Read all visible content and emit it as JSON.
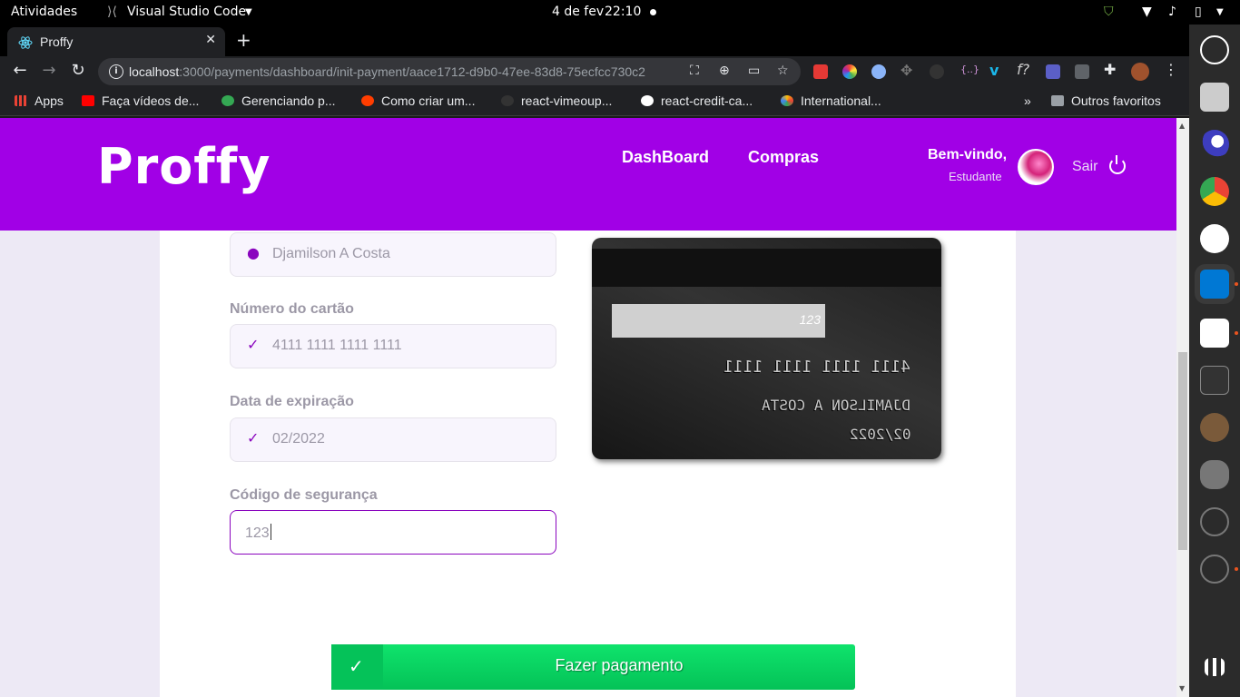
{
  "system_bar": {
    "activities": "Atividades",
    "app_name": "Visual Studio Code",
    "date": "4 de fev",
    "time": "22:10"
  },
  "browser": {
    "tab_title": "Proffy",
    "url_host": "localhost",
    "url_path": ":3000/payments/dashboard/init-payment/aace1712-d9b0-47ee-83d8-75ecfcc730c2",
    "bookmarks": [
      {
        "label": "Apps",
        "color": "#e94235"
      },
      {
        "label": "Faça vídeos de...",
        "color": "#ff0000"
      },
      {
        "label": "Gerenciando p...",
        "color": "#34a853"
      },
      {
        "label": "Como criar um...",
        "color": "#ff3d00"
      },
      {
        "label": "react-vimeoup...",
        "color": "#333333"
      },
      {
        "label": "react-credit-ca...",
        "color": "#ffffff"
      },
      {
        "label": "International...",
        "color": "#ff9800"
      }
    ],
    "overflow": "»",
    "other_bookmarks": "Outros favoritos"
  },
  "header": {
    "logo": "Proffy",
    "nav": [
      "DashBoard",
      "Compras"
    ],
    "welcome": "Bem-vindo,",
    "role": "Estudante",
    "logout": "Sair"
  },
  "form": {
    "name_value": "Djamilson A Costa",
    "card_number_label": "Número do cartão",
    "card_number_value": "4111 1111 1111 1111",
    "expiry_label": "Data de expiração",
    "expiry_value": "02/2022",
    "cvc_label": "Código de segurança",
    "cvc_value": "123"
  },
  "card_preview": {
    "cvc": "123",
    "number": "4111 1111 1111 1111",
    "holder": "DJAMILSON A COSTA",
    "expiry": "02/2022"
  },
  "actions": {
    "pay_label": "Fazer pagamento"
  },
  "colors": {
    "brand": "#a100e6",
    "accent": "#8a05be",
    "pay_button": "#04d361"
  }
}
